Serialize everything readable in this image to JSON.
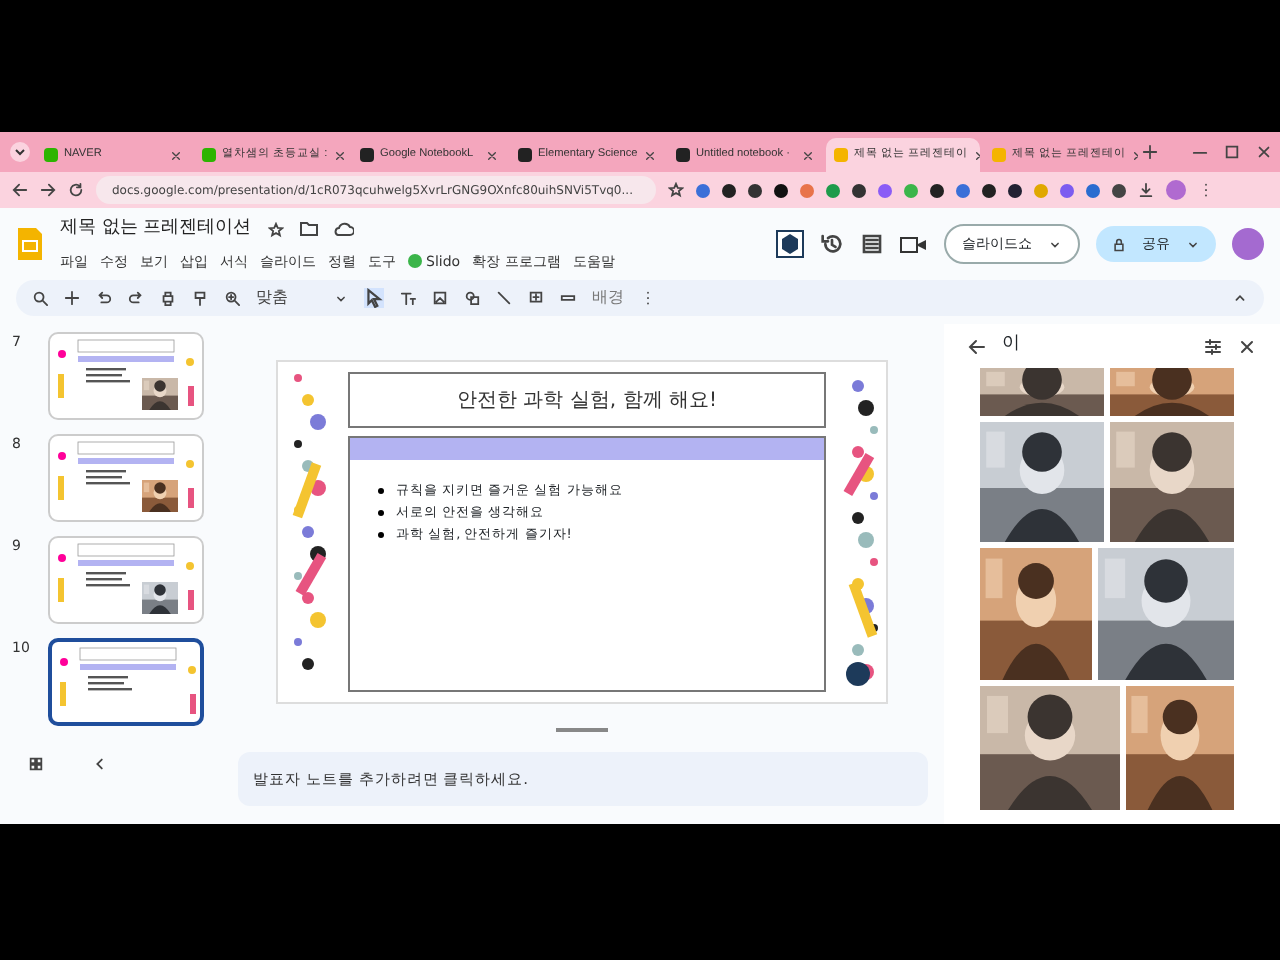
{
  "browser_tabs": [
    {
      "label": "NAVER",
      "selected": false,
      "color": "#2db400"
    },
    {
      "label": "열차샘의 초등교실 :",
      "selected": false,
      "color": "#2db400"
    },
    {
      "label": "Google NotebookL",
      "selected": false,
      "color": "#222222"
    },
    {
      "label": "Elementary Science",
      "selected": false,
      "color": "#222222"
    },
    {
      "label": "Untitled notebook ·",
      "selected": false,
      "color": "#222222"
    },
    {
      "label": "제목 없는 프레젠테이",
      "selected": true,
      "color": "#f4b400"
    },
    {
      "label": "제목 없는 프레젠테이",
      "selected": false,
      "color": "#f4b400"
    }
  ],
  "address_bar": {
    "url": "docs.google.com/presentation/d/1cR073qcuhwelg5XvrLrGNG9OXnfc80uihSNVi5Tvq0..."
  },
  "document": {
    "title": "제목 없는 프레젠테이션",
    "menu": [
      "파일",
      "수정",
      "보기",
      "삽입",
      "서식",
      "슬라이드",
      "정렬",
      "도구",
      "Slido",
      "확장 프로그램",
      "도움말"
    ]
  },
  "toolbar": {
    "zoom": "맞춤",
    "background": "배경"
  },
  "header_buttons": {
    "slideshow": "슬라이드쇼",
    "share": "공유"
  },
  "slides": [
    {
      "number": "7",
      "selected": false,
      "picture": true
    },
    {
      "number": "8",
      "selected": false,
      "picture": true
    },
    {
      "number": "9",
      "selected": false,
      "picture": true
    },
    {
      "number": "10",
      "selected": true,
      "picture": false
    }
  ],
  "slide": {
    "title": "안전한 과학 실험, 함께 해요!",
    "bullets": [
      "규칙을 지키면 즐거운 실험 가능해요",
      "서로의 안전을 생각해요",
      "과학 실험, 안전하게 즐기자!"
    ]
  },
  "speaker_notes": {
    "placeholder": "발표자 노트를 추가하려면 클릭하세요."
  },
  "gif_panel": {
    "query": "이"
  }
}
